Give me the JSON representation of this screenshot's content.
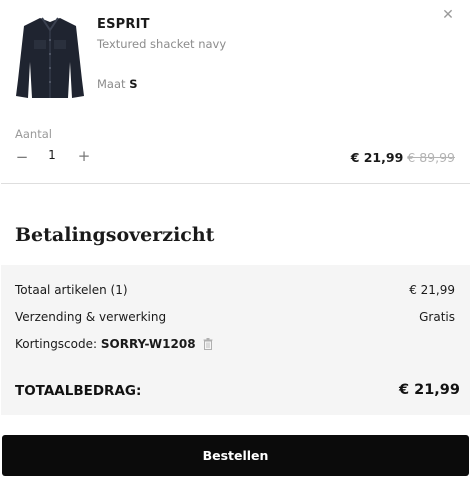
{
  "item": {
    "brand": "ESPRIT",
    "name": "Textured shacket navy",
    "size_label": "Maat",
    "size_value": "S",
    "quantity_label": "Aantal",
    "quantity": "1",
    "price_now": "€ 21,99",
    "price_old": "€ 89,99",
    "icons": {
      "close": "close-icon",
      "minus": "minus-icon",
      "plus": "plus-icon"
    }
  },
  "summary": {
    "title": "Betalingsoverzicht",
    "rows": [
      {
        "label": "Totaal artikelen (1)",
        "value": "€ 21,99"
      },
      {
        "label": "Verzending & verwerking",
        "value": "Gratis"
      }
    ],
    "discount_label": "Kortingscode:",
    "discount_code": "SORRY-W1208",
    "total_label": "TOTAALBEDRAG:",
    "total_value": "€ 21,99"
  },
  "checkout": {
    "button_label": "Bestellen"
  },
  "colors": {
    "button_bg": "#0b0b0b",
    "summary_bg": "#f5f5f5",
    "muted_text": "#8c8c8c"
  }
}
